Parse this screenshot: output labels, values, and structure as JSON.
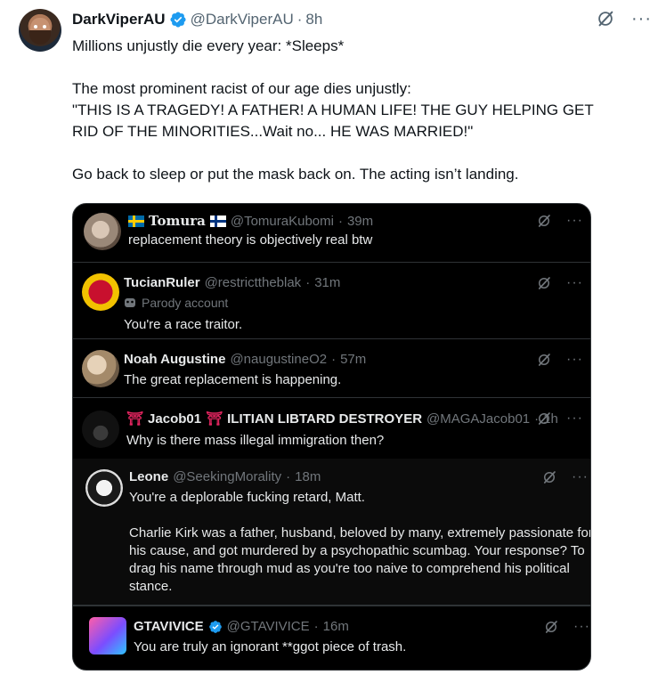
{
  "post": {
    "name": "DarkViperAU",
    "handle": "@DarkViperAU",
    "separator": "·",
    "time": "8h",
    "lines": [
      "Millions unjustly die every year: *Sleeps*",
      "",
      "The most prominent racist of our age dies unjustly:",
      "\"THIS IS A TRAGEDY! A FATHER! A HUMAN LIFE! THE GUY HELPING GET",
      "RID OF THE MINORITIES...Wait no... HE WAS MARRIED!\"",
      "",
      "Go back to sleep or put the mask back on. The acting isn’t landing."
    ],
    "more_label": "···"
  },
  "replies": [
    {
      "name": "Tomura",
      "handle": "@TomuraKubomi",
      "time": "39m",
      "lines": [
        "replacement theory is objectively real btw"
      ]
    },
    {
      "name": "TucianRuler",
      "handle": "@restricttheblak",
      "time": "31m",
      "badge": "Parody account",
      "lines": [
        "You're a race traitor."
      ]
    },
    {
      "name": "Noah Augustine",
      "handle": "@naugustineO2",
      "time": "57m",
      "lines": [
        "The great replacement is happening."
      ]
    },
    {
      "name": "Jacob01",
      "name_suffix": "ILITIAN LIBTARD DESTROYER",
      "handle": "@MAGAJacob01",
      "time": "1h",
      "lines": [
        "Why is there mass illegal immigration then?"
      ]
    },
    {
      "name": "Leone",
      "handle": "@SeekingMorality",
      "time": "18m",
      "lines": [
        "You're a deplorable fucking retard, Matt.",
        "",
        "Charlie Kirk was a father, husband, beloved by many, extremely passionate for",
        "his cause, and got murdered by a psychopathic scumbag. Your response? To",
        "drag his name through mud as you're too naive to comprehend his political",
        "stance."
      ]
    },
    {
      "name": "GTAVIVICE",
      "handle": "@GTAVIVICE",
      "time": "16m",
      "lines": [
        "You are truly an ignorant **ggot piece of trash."
      ]
    }
  ],
  "dot": "·",
  "colors": {
    "verified": "#1d9bf0",
    "dark_bg": "#000000",
    "muted": "#536471"
  }
}
